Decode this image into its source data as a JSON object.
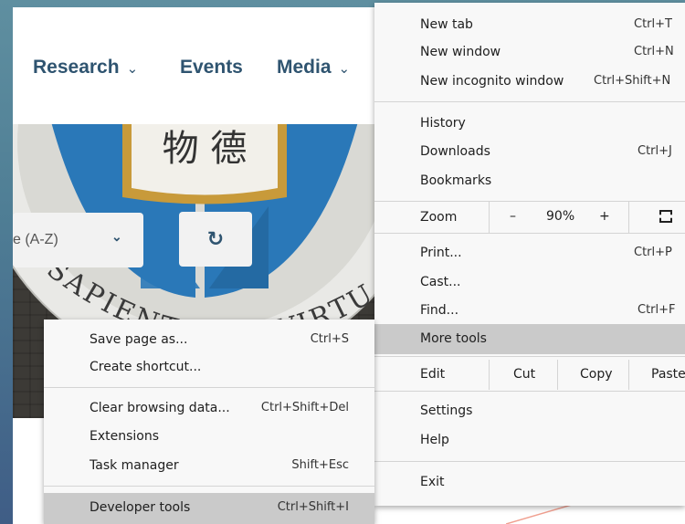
{
  "site_nav": {
    "items": [
      {
        "label": "Research",
        "has_dropdown": true
      },
      {
        "label": "Events",
        "has_dropdown": false
      },
      {
        "label": "Media",
        "has_dropdown": true
      }
    ],
    "chevron": "⌄"
  },
  "hero": {
    "crest_text_top": "物 德",
    "crest_text_ribbon": "SAPIENTIA ET VIRTUS"
  },
  "filters": {
    "sort_value": "e (A-Z)",
    "sort_chevron": "⌄",
    "reset_icon": "↻"
  },
  "main_menu": {
    "items": [
      {
        "label": "New tab",
        "shortcut": "Ctrl+T"
      },
      {
        "label": "New window",
        "shortcut": "Ctrl+N"
      },
      {
        "label": "New incognito window",
        "shortcut": "Ctrl+Shift+N"
      },
      {
        "label": "History",
        "shortcut": ""
      },
      {
        "label": "Downloads",
        "shortcut": "Ctrl+J"
      },
      {
        "label": "Bookmarks",
        "shortcut": ""
      },
      {
        "label": "Print...",
        "shortcut": "Ctrl+P"
      },
      {
        "label": "Cast...",
        "shortcut": ""
      },
      {
        "label": "Find...",
        "shortcut": "Ctrl+F"
      },
      {
        "label": "More tools",
        "shortcut": ""
      },
      {
        "label": "Settings",
        "shortcut": ""
      },
      {
        "label": "Help",
        "shortcut": ""
      },
      {
        "label": "Exit",
        "shortcut": ""
      }
    ],
    "zoom": {
      "label": "Zoom",
      "minus": "–",
      "value": "90%",
      "plus": "+"
    },
    "edit": {
      "label": "Edit",
      "cut": "Cut",
      "copy": "Copy",
      "paste": "Paste"
    }
  },
  "sub_menu": {
    "items": [
      {
        "label": "Save page as...",
        "shortcut": "Ctrl+S"
      },
      {
        "label": "Create shortcut...",
        "shortcut": ""
      },
      {
        "label": "Clear browsing data...",
        "shortcut": "Ctrl+Shift+Del"
      },
      {
        "label": "Extensions",
        "shortcut": ""
      },
      {
        "label": "Task manager",
        "shortcut": "Shift+Esc"
      },
      {
        "label": "Developer tools",
        "shortcut": "Ctrl+Shift+I"
      }
    ]
  },
  "colors": {
    "nav_text": "#2f5470",
    "menu_bg": "#f8f8f8",
    "menu_highlight": "#cacaca",
    "crest_blue": "#2a78b8",
    "crest_gold": "#c89a3a"
  }
}
